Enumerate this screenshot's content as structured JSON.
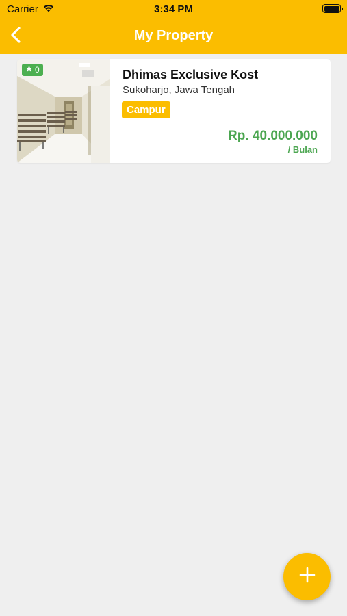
{
  "status_bar": {
    "carrier": "Carrier",
    "time": "3:34 PM"
  },
  "nav": {
    "title": "My Property",
    "back_icon": "chevron-left-icon"
  },
  "properties": [
    {
      "rating": "0",
      "name": "Dhimas Exclusive Kost",
      "location": "Sukoharjo, Jawa Tengah",
      "type": "Campur",
      "price": "Rp. 40.000.000",
      "period": "/ Bulan"
    }
  ],
  "fab": {
    "icon": "plus-icon"
  },
  "colors": {
    "primary": "#fbbd00",
    "price_green": "#4ca651",
    "rating_green": "#4caf50",
    "background": "#efefef"
  }
}
